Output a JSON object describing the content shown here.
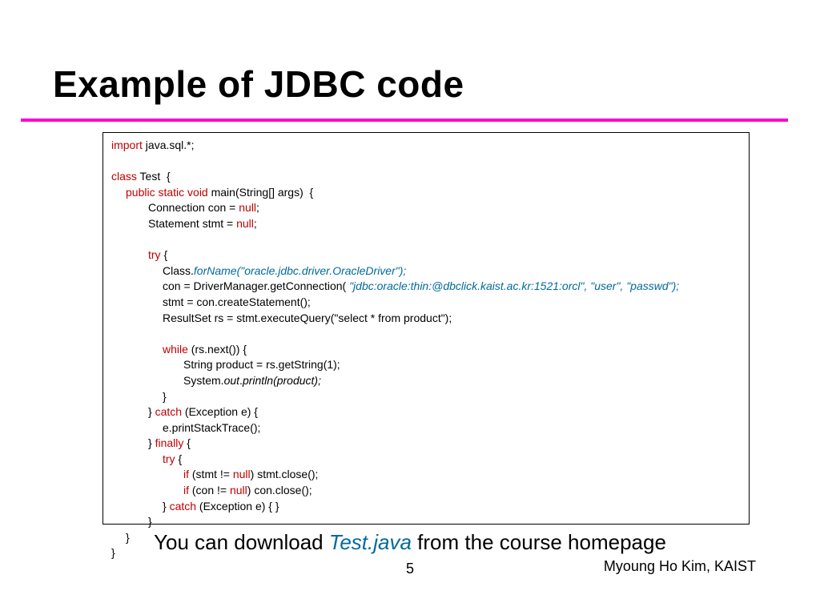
{
  "title": "Example of JDBC code",
  "code": {
    "l1a": "import",
    "l1b": " java.sql.*;",
    "l2a": "class",
    "l2b": " Test  {",
    "l3a": "public static void",
    "l3b": " main(String[] args)  {",
    "l4a": "Connection con = ",
    "l4b": "null",
    "l4c": ";",
    "l5a": "Statement stmt = ",
    "l5b": "null",
    "l5c": ";",
    "l6a": "try",
    "l6b": " {",
    "l7a": "Class.",
    "l7b": "forName(\"oracle.jdbc.driver.OracleDriver\");",
    "l8a": "con = DriverManager.getConnection( ",
    "l8b": "\"jdbc:oracle:thin:@dbclick.kaist.ac.kr:1521:orcl\", \"user\", \"passwd\");",
    "l9": "stmt = con.createStatement();",
    "l10": "ResultSet rs = stmt.executeQuery(\"select * from product\");",
    "l11a": "while",
    "l11b": " (rs.next()) {",
    "l12": "String product = rs.getString(1);",
    "l13a": "System.",
    "l13b": "out",
    "l13c": ".",
    "l13d": "println(product);",
    "l14": "}",
    "l15a": "} ",
    "l15b": "catch",
    "l15c": " (Exception e) {",
    "l16": "e.printStackTrace();",
    "l17a": "} ",
    "l17b": "finally",
    "l17c": " {",
    "l18a": "try",
    "l18b": " {",
    "l19a": "if",
    "l19b": " (stmt != ",
    "l19c": "null",
    "l19d": ") stmt.close();",
    "l20a": "if",
    "l20b": " (con != ",
    "l20c": "null",
    "l20d": ") con.close();",
    "l21a": "} ",
    "l21b": "catch",
    "l21c": " (Exception e) { }",
    "l22": "}",
    "l23": "}",
    "l24": "}"
  },
  "caption": {
    "pre": "You can download ",
    "file": "Test.java",
    "post": " from the course homepage"
  },
  "page": "5",
  "author": "Myoung Ho Kim, KAIST"
}
